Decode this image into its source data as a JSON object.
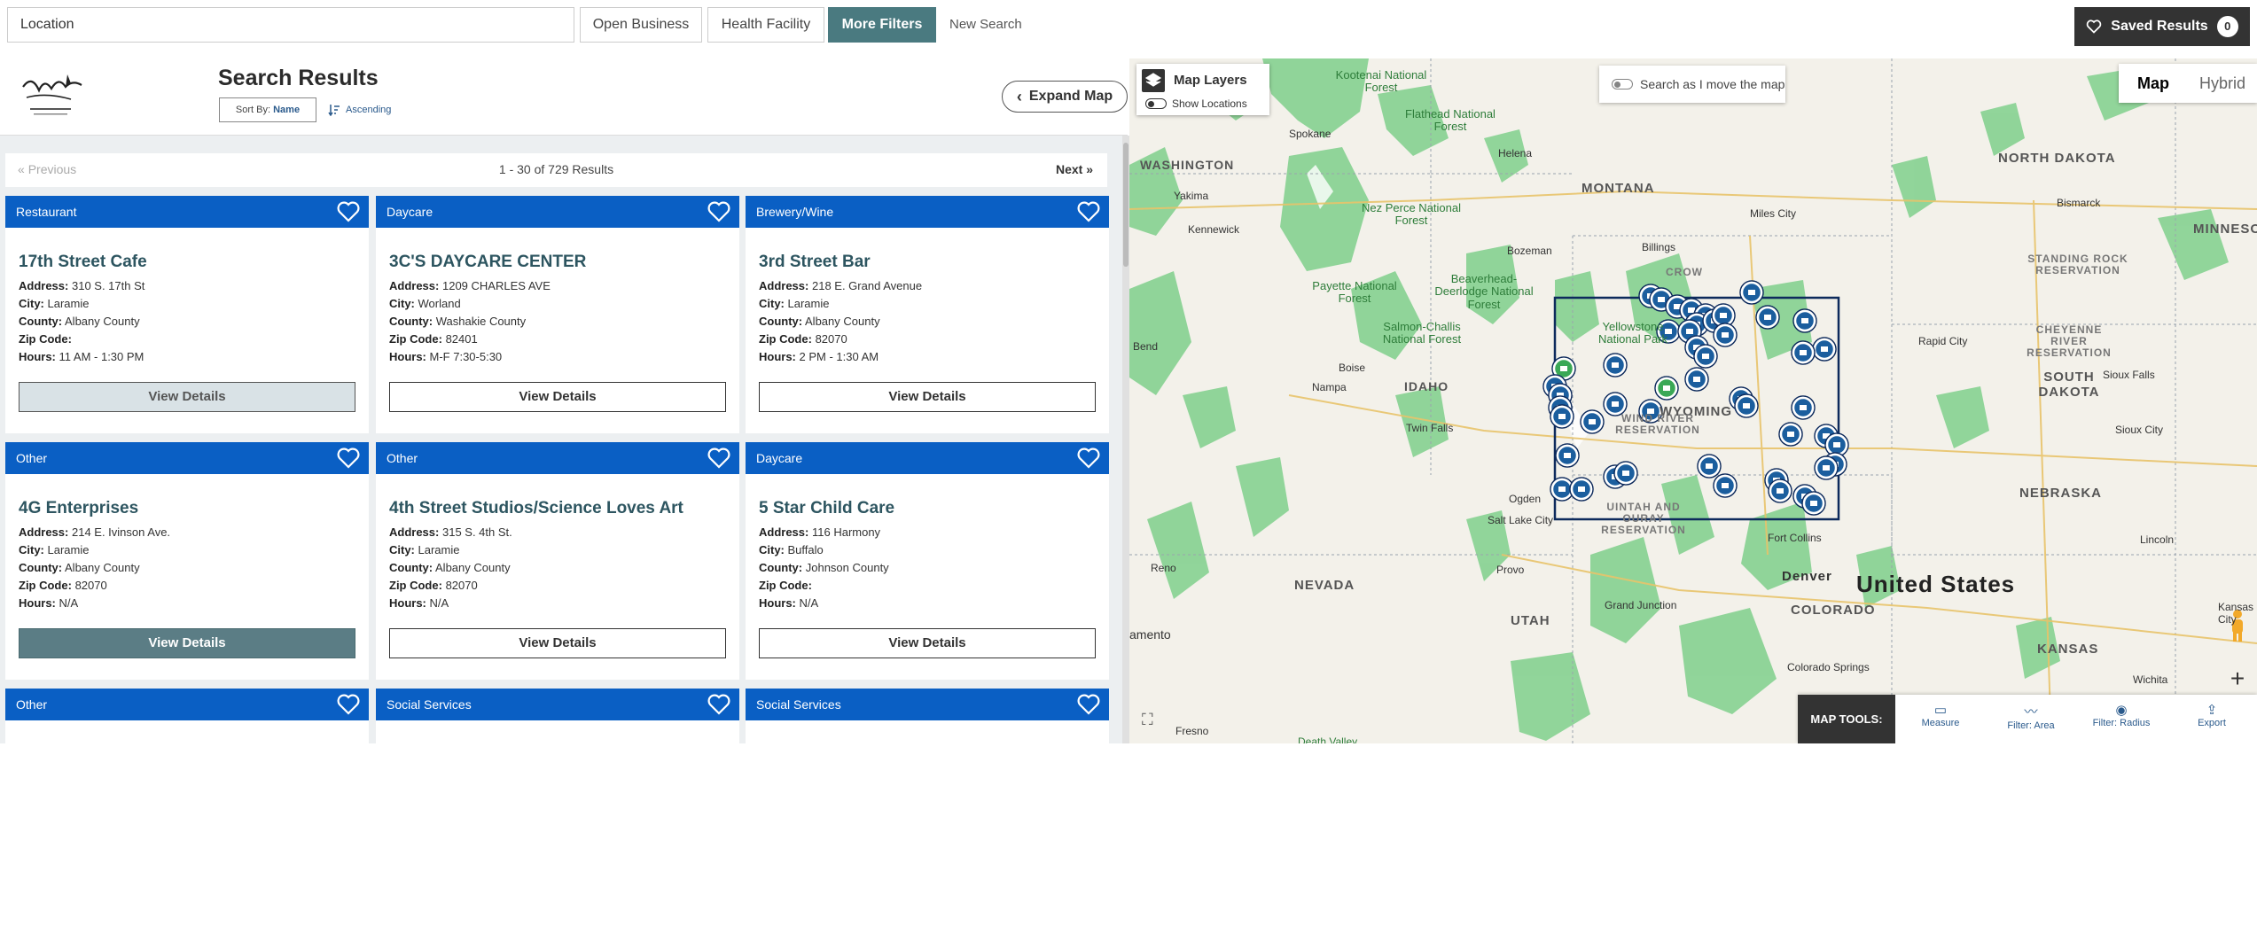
{
  "topbar": {
    "location_placeholder": "Location",
    "chips": [
      "Open Business",
      "Health Facility",
      "More Filters"
    ],
    "new_search": "New Search",
    "saved_label": "Saved Results",
    "saved_count": "0"
  },
  "header": {
    "title": "Search Results",
    "sort_by_label": "Sort By:",
    "sort_by_value": "Name",
    "ascending": "Ascending",
    "expand_map": "Expand Map"
  },
  "pager": {
    "previous": "Previous",
    "range": "1 - 30 of 729 Results",
    "next": "Next"
  },
  "labels": {
    "address": "Address:",
    "city": "City:",
    "county": "County:",
    "zip": "Zip Code:",
    "hours": "Hours:",
    "view_details": "View Details"
  },
  "cards": [
    {
      "category": "Restaurant",
      "name": "17th Street Cafe",
      "address": "310 S. 17th St",
      "city": "Laramie",
      "county": "Albany County",
      "zip": "",
      "hours": "11 AM - 1:30 PM"
    },
    {
      "category": "Daycare",
      "name": "3C'S DAYCARE CENTER",
      "address": "1209 CHARLES AVE",
      "city": "Worland",
      "county": "Washakie County",
      "zip": "82401",
      "hours": "M-F 7:30-5:30"
    },
    {
      "category": "Brewery/Wine",
      "name": "3rd Street Bar",
      "address": "218 E. Grand Avenue",
      "city": "Laramie",
      "county": "Albany County",
      "zip": "82070",
      "hours": "2 PM - 1:30 AM"
    },
    {
      "category": "Other",
      "name": "4G Enterprises",
      "address": "214 E. Ivinson Ave.",
      "city": "Laramie",
      "county": "Albany County",
      "zip": "82070",
      "hours": "N/A"
    },
    {
      "category": "Other",
      "name": "4th Street Studios/Science Loves Art",
      "address": "315 S. 4th St.",
      "city": "Laramie",
      "county": "Albany County",
      "zip": "82070",
      "hours": "N/A"
    },
    {
      "category": "Daycare",
      "name": "5 Star Child Care",
      "address": "116 Harmony",
      "city": "Buffalo",
      "county": "Johnson County",
      "zip": "",
      "hours": "N/A"
    },
    {
      "category": "Other"
    },
    {
      "category": "Social Services"
    },
    {
      "category": "Social Services"
    }
  ],
  "map": {
    "layers_label": "Map Layers",
    "show_locations": "Show Locations",
    "search_as_move": "Search as I move the map",
    "type_map": "Map",
    "type_hybrid": "Hybrid",
    "tools_title": "MAP TOOLS:",
    "tools": [
      "Measure",
      "Filter: Area",
      "Filter: Radius",
      "Export"
    ],
    "places": {
      "kootenai": "Kootenai National Forest",
      "flathead": "Flathead National Forest",
      "spokane": "Spokane",
      "washington": "WASHINGTON",
      "montana": "MONTANA",
      "north_dakota": "NORTH DAKOTA",
      "minnesota": "MINNESOTA",
      "yakima": "Yakima",
      "kennewick": "Kennewick",
      "nez_perce": "Nez Perce National Forest",
      "helena": "Helena",
      "miles_city": "Miles City",
      "bismarck": "Bismarck",
      "billings": "Billings",
      "bozeman": "Bozeman",
      "crow": "CROW",
      "beaverhead": "Beaverhead-Deerlodge National Forest",
      "payette": "Payette National Forest",
      "salmon": "Salmon-Challis National Forest",
      "yellowstone": "Yellowstone National Park",
      "standing_rock": "STANDING ROCK RESERVATION",
      "cheyenne_river": "CHEYENNE RIVER RESERVATION",
      "south_dakota": "SOUTH DAKOTA",
      "rapid_city": "Rapid City",
      "idaho": "IDAHO",
      "boise": "Boise",
      "nampa": "Nampa",
      "bend": "Bend",
      "twin_falls": "Twin Falls",
      "wyoming": "WYOMING",
      "sioux_falls": "Sioux Falls",
      "sioux_city": "Sioux City",
      "wind_river": "WIND RIVER RESERVATION",
      "salt_lake": "Salt Lake City",
      "provo": "Provo",
      "reno": "Reno",
      "nevada": "NEVADA",
      "fort_collins": "Fort Collins",
      "denver": "Denver",
      "nebraska": "NEBRASKA",
      "lincoln": "Lincoln",
      "united_states": "United States",
      "utah": "UTAH",
      "colorado": "COLORADO",
      "kansas": "KANSAS",
      "wichita": "Wichita",
      "kansas_city": "Kansas City",
      "sacramento": "amento",
      "fresno": "Fresno",
      "grand_junction": "Grand Junction",
      "colorado_springs": "Colorado Springs",
      "death_valley": "Death Valley",
      "ogden": "Ogden",
      "uintah": "UINTAH AND OURAY RESERVATION"
    }
  }
}
